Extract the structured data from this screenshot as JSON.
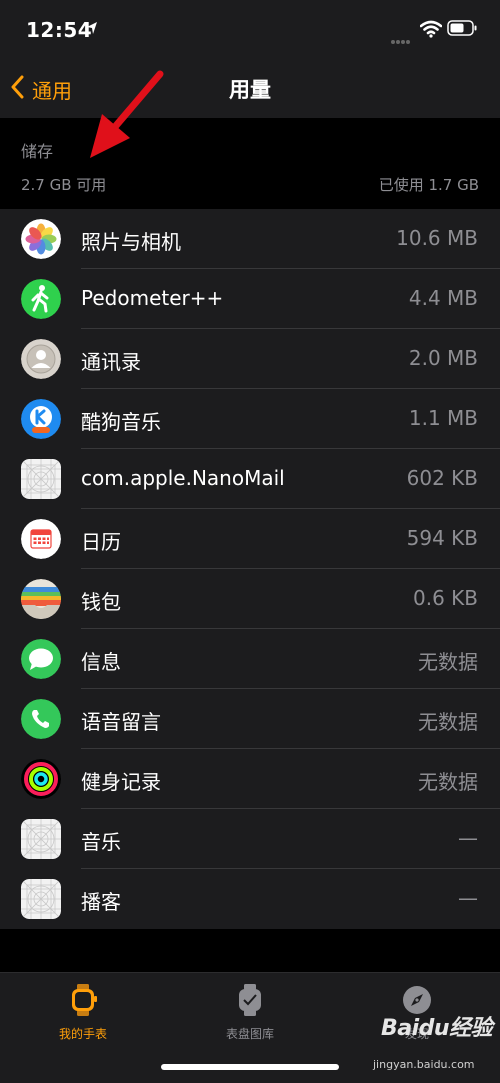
{
  "status_bar": {
    "time": "12:54"
  },
  "nav": {
    "back_label": "通用",
    "title": "用量"
  },
  "storage": {
    "section_title": "储存",
    "available": "2.7 GB 可用",
    "used": "已使用 1.7 GB"
  },
  "apps": [
    {
      "name": "照片与相机",
      "size": "10.6 MB",
      "icon": "photos-icon"
    },
    {
      "name": "Pedometer++",
      "size": "4.4 MB",
      "icon": "pedometer-icon"
    },
    {
      "name": "通讯录",
      "size": "2.0 MB",
      "icon": "contacts-icon"
    },
    {
      "name": "酷狗音乐",
      "size": "1.1 MB",
      "icon": "kugou-icon"
    },
    {
      "name": "com.apple.NanoMail",
      "size": "602 KB",
      "icon": "placeholder-app-icon"
    },
    {
      "name": "日历",
      "size": "594 KB",
      "icon": "calendar-icon"
    },
    {
      "name": "钱包",
      "size": "0.6 KB",
      "icon": "wallet-icon"
    },
    {
      "name": "信息",
      "size": "无数据",
      "icon": "messages-icon"
    },
    {
      "name": "语音留言",
      "size": "无数据",
      "icon": "phone-icon"
    },
    {
      "name": "健身记录",
      "size": "无数据",
      "icon": "activity-icon"
    },
    {
      "name": "音乐",
      "size": "—",
      "icon": "placeholder-app-icon"
    },
    {
      "name": "播客",
      "size": "—",
      "icon": "placeholder-app-icon"
    }
  ],
  "tabs": [
    {
      "label": "我的手表",
      "icon": "watch-icon",
      "active": true
    },
    {
      "label": "表盘图库",
      "icon": "watch-face-gallery-icon",
      "active": false
    },
    {
      "label": "发现",
      "icon": "compass-icon",
      "active": false
    }
  ],
  "watermark": {
    "brand": "Baidu经验",
    "url": "jingyan.baidu.com"
  },
  "colors": {
    "accent": "#ff9f0a",
    "background": "#000000",
    "cell": "#1c1c1e",
    "annotation": "#e0101a"
  }
}
